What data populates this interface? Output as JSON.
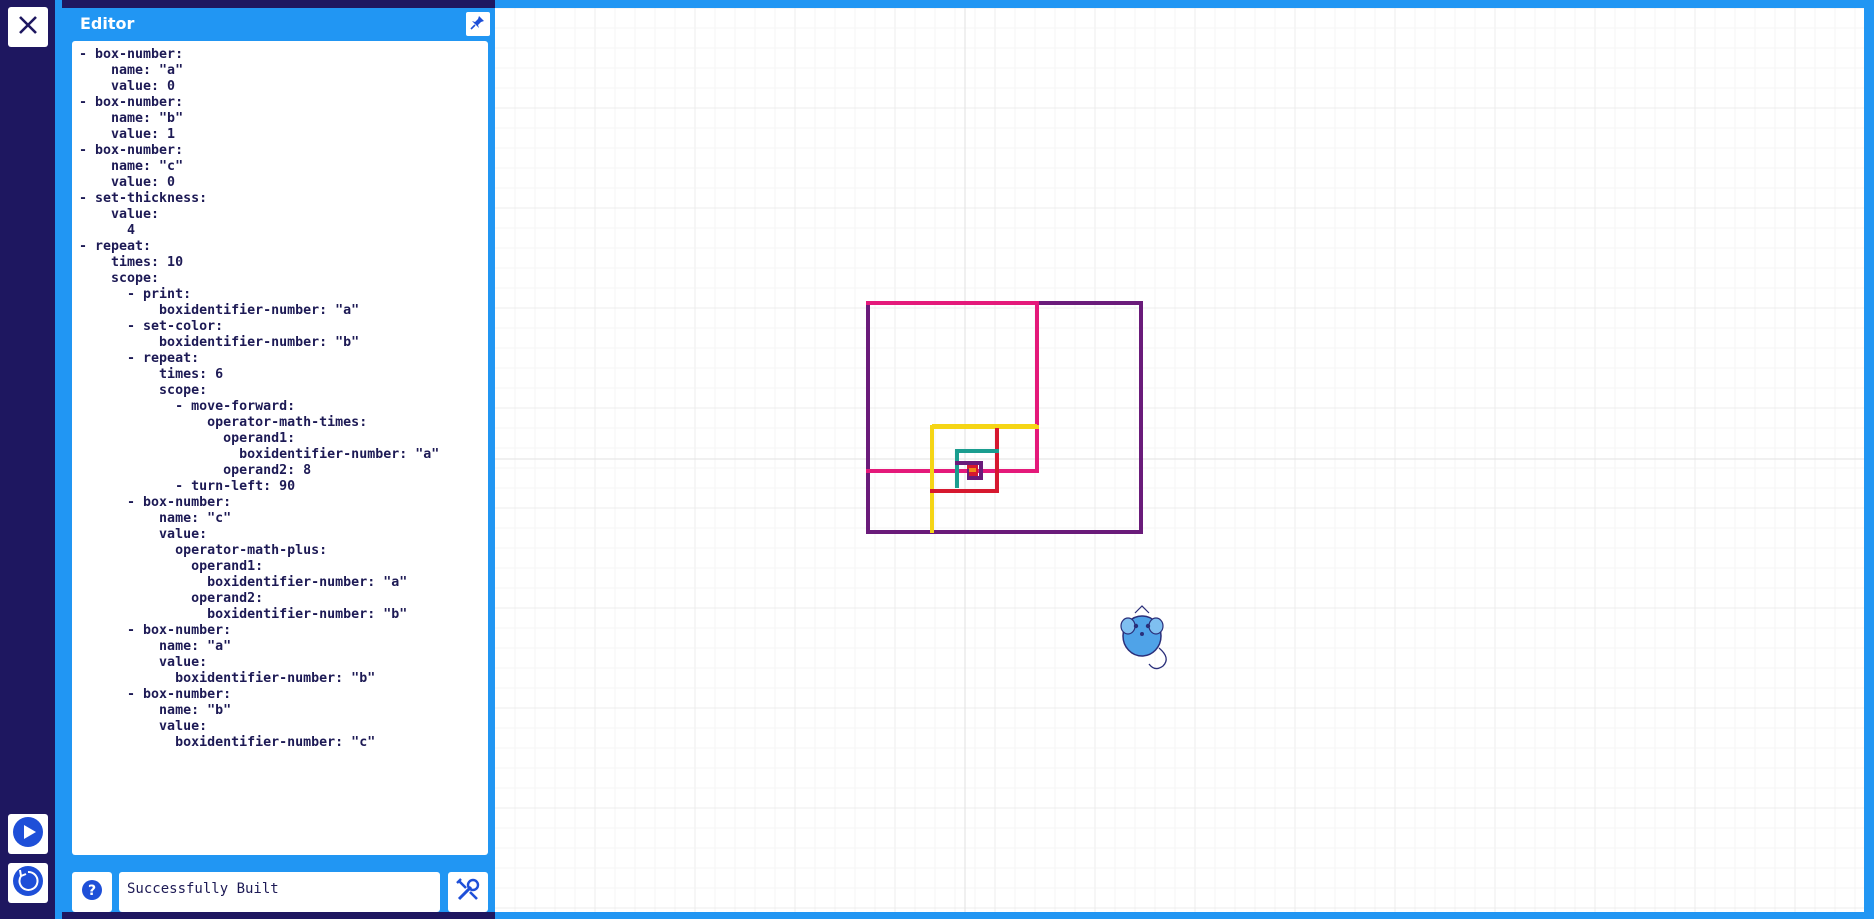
{
  "editor": {
    "title": "Editor",
    "code_lines": [
      "- box-number:",
      "    name: \"a\"",
      "    value: 0",
      "- box-number:",
      "    name: \"b\"",
      "    value: 1",
      "- box-number:",
      "    name: \"c\"",
      "    value: 0",
      "- set-thickness:",
      "    value:",
      "      4",
      "- repeat:",
      "    times: 10",
      "    scope:",
      "      - print:",
      "          boxidentifier-number: \"a\"",
      "      - set-color:",
      "          boxidentifier-number: \"b\"",
      "      - repeat:",
      "          times: 6",
      "          scope:",
      "            - move-forward:",
      "                operator-math-times:",
      "                  operand1:",
      "                    boxidentifier-number: \"a\"",
      "                  operand2: 8",
      "            - turn-left: 90",
      "      - box-number:",
      "          name: \"c\"",
      "          value:",
      "            operator-math-plus:",
      "              operand1:",
      "                boxidentifier-number: \"a\"",
      "              operand2:",
      "                boxidentifier-number: \"b\"",
      "      - box-number:",
      "          name: \"a\"",
      "          value:",
      "            boxidentifier-number: \"b\"",
      "      - box-number:",
      "          name: \"b\"",
      "          value:",
      "            boxidentifier-number: \"c\""
    ]
  },
  "footer": {
    "status": "Successfully Built"
  },
  "icons": {
    "close": "close-icon",
    "pin": "pin-icon",
    "run": "play-icon",
    "reset": "reset-icon",
    "help": "help-icon",
    "build": "tools-icon"
  },
  "colors": {
    "rail": "#1e1760",
    "accent": "#2196f3",
    "code_text": "#1d1a55",
    "stroke_purple": "#6a1b7a",
    "stroke_magenta": "#e4197a",
    "stroke_yellow": "#f5d515",
    "stroke_red": "#d6182f",
    "stroke_teal": "#1a9d8f",
    "stroke_orange": "#f08a18"
  }
}
